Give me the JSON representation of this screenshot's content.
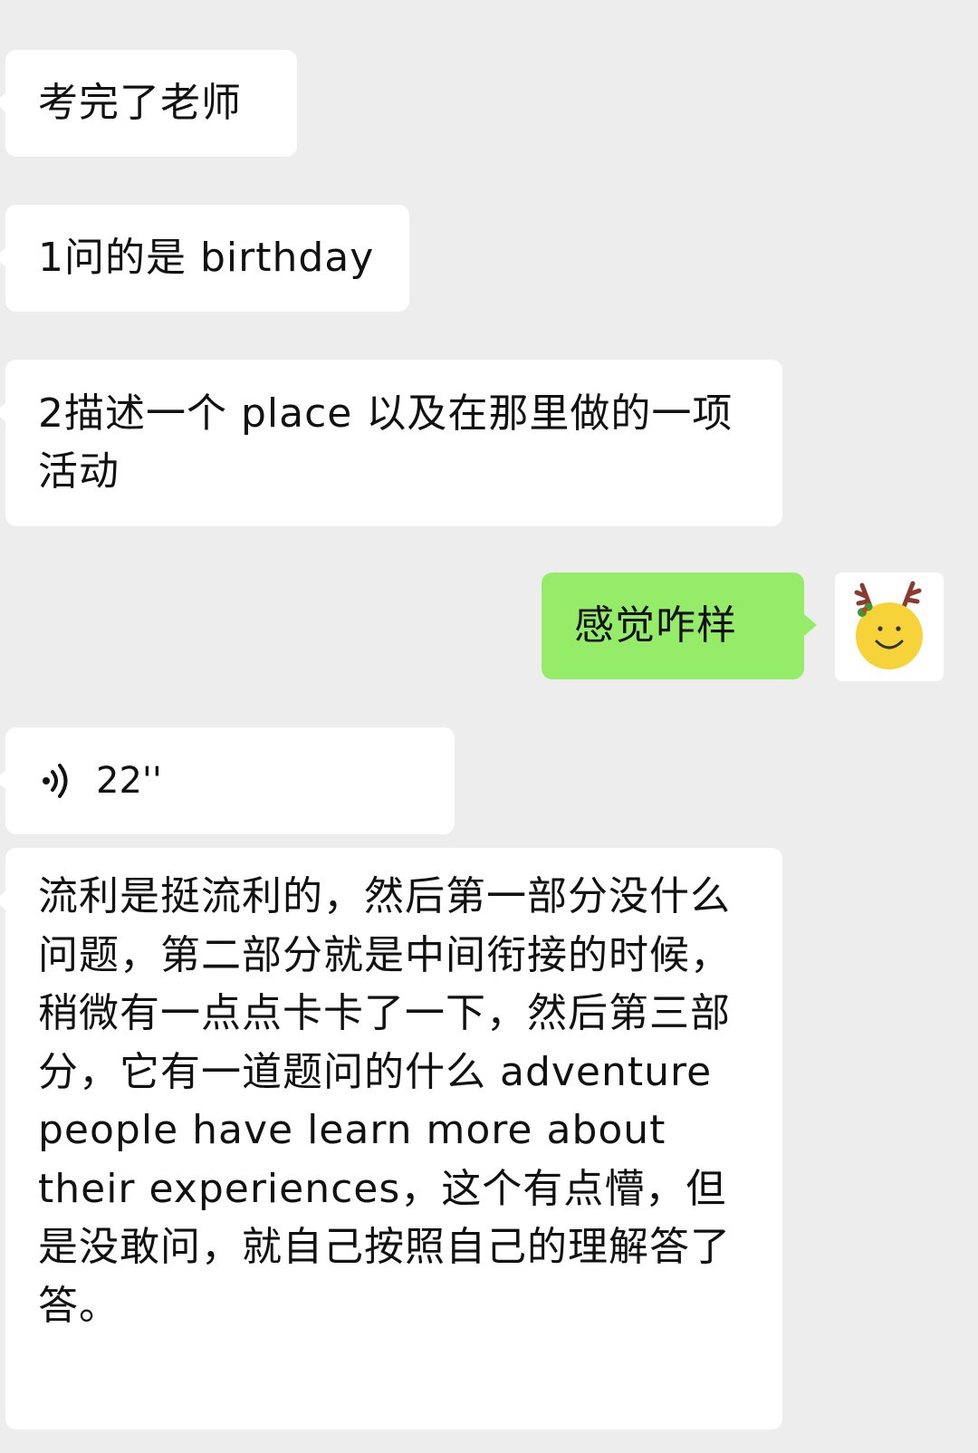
{
  "messages": [
    {
      "id": "msg1",
      "side": "in",
      "type": "text",
      "text": "考完了老师"
    },
    {
      "id": "msg2",
      "side": "in",
      "type": "text",
      "text": "1问的是 birthday"
    },
    {
      "id": "msg3",
      "side": "in",
      "type": "text",
      "text": "2描述一个 place 以及在那里做的一项活动"
    },
    {
      "id": "msg4",
      "side": "out",
      "type": "text",
      "text": "感觉咋样"
    },
    {
      "id": "msg-voice",
      "side": "in",
      "type": "voice",
      "duration": "22''"
    },
    {
      "id": "msg5",
      "side": "in",
      "type": "text",
      "text": "流利是挺流利的，然后第一部分没什么问题，第二部分就是中间衔接的时候，稍微有一点点卡卡了一下，然后第三部分，它有一道题问的什么 adventure people have learn more about their experiences，这个有点懵，但是没敢问，就自己按照自己的理解答了答。"
    }
  ],
  "avatar": {
    "icon": "smiley-reindeer-icon",
    "face_color": "#f7d33a",
    "antler_color": "#8b3a2f"
  },
  "colors": {
    "background": "#ededed",
    "incoming_bubble": "#ffffff",
    "outgoing_bubble": "#95ec69",
    "text": "#111111"
  }
}
